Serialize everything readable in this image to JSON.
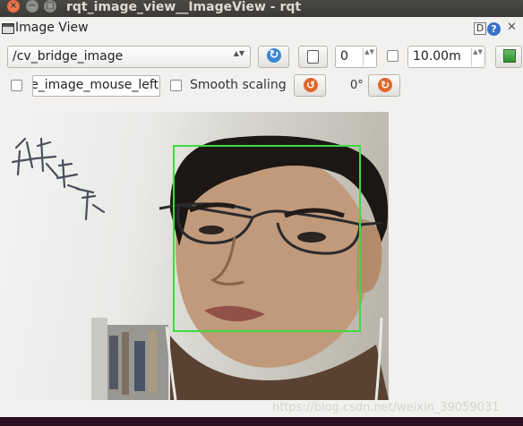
{
  "window": {
    "title": "rqt_image_view__ImageView - rqt",
    "close_glyph": "×",
    "min_glyph": "−",
    "max_glyph": "□"
  },
  "panel": {
    "title": "Image View",
    "d_badge": "D",
    "help_badge": "?",
    "close_glyph": "✕"
  },
  "toolbar": {
    "topic_value": "/cv_bridge_image",
    "topic_arrows": "▲▼",
    "refresh_glyph": "↻",
    "spin_value": "0",
    "spin_arrows": "▲▼",
    "rate_value": "10.00m",
    "rate_arrows": "▲▼"
  },
  "options": {
    "mouse_topic_value": "e_image_mouse_left",
    "smooth_label": "Smooth scaling",
    "rotate_left_glyph": "↺",
    "rotate_right_glyph": "↻",
    "angle": "0°"
  },
  "footer": {
    "watermark": "https://blog.csdn.net/weixin_39059031"
  },
  "colors": {
    "detection_box": "#3ddc3d",
    "title_bar": "#3b3a36",
    "accent_blue": "#3d86d6",
    "accent_orange": "#e0682c"
  }
}
